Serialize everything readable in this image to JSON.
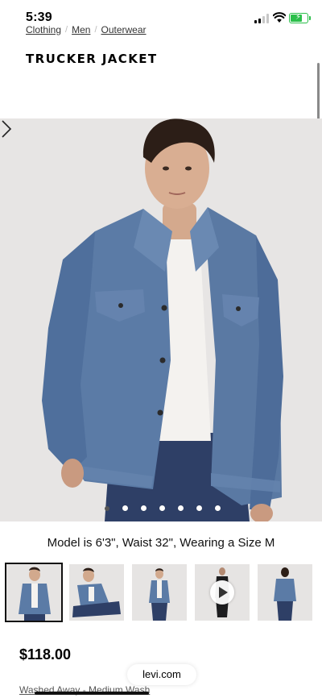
{
  "status_bar": {
    "time": "5:39"
  },
  "breadcrumb": [
    "Clothing",
    "Men",
    "Outerwear"
  ],
  "product": {
    "title": "TRUCKER JACKET",
    "model_info": "Model is 6'3\", Waist 32\", Wearing a Size M",
    "price": "$118.00",
    "color": "Washed Away - Medium Wash"
  },
  "carousel": {
    "slide_count": 7,
    "active_index": 0
  },
  "thumbnails": [
    {
      "type": "image"
    },
    {
      "type": "image"
    },
    {
      "type": "image"
    },
    {
      "type": "video"
    },
    {
      "type": "image"
    }
  ],
  "browser": {
    "domain": "levi.com"
  },
  "colors": {
    "denim": "#5b7ba6",
    "background": "#e7e5e4",
    "battery": "#2bbf4a"
  },
  "icons": [
    "signal-icon",
    "wifi-icon",
    "battery-icon",
    "chevron-right-icon",
    "play-icon"
  ]
}
